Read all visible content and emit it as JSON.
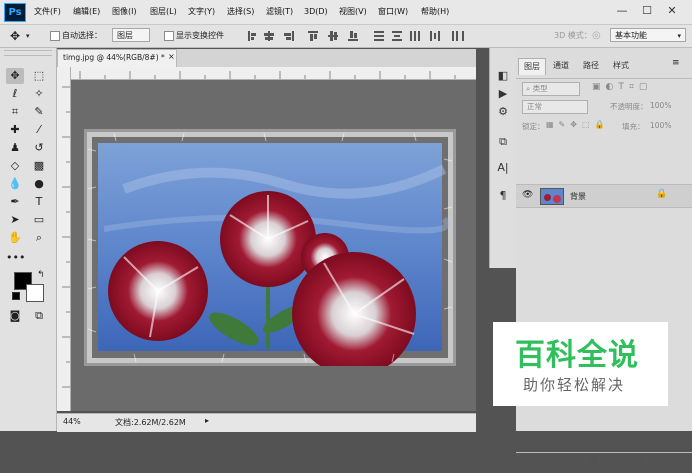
{
  "app": {
    "logo": "Ps"
  },
  "menu": [
    "文件(F)",
    "编辑(E)",
    "图像(I)",
    "图层(L)",
    "文字(Y)",
    "选择(S)",
    "滤镜(T)",
    "3D(D)",
    "视图(V)",
    "窗口(W)",
    "帮助(H)"
  ],
  "window_controls": {
    "minimize": "—",
    "maximize": "☐",
    "close": "✕"
  },
  "options": {
    "auto_select_label": "自动选择：",
    "auto_select_value": "图层",
    "show_transform_label": "显示变换控件",
    "mode_3d_label": "3D 模式：",
    "workspace": "基本功能"
  },
  "document": {
    "tab_title": "timg.jpg @ 44%(RGB/8#) *",
    "zoom": "44%",
    "doc_info": "文档:2.62M/2.62M"
  },
  "layers_panel": {
    "tabs": [
      "图层",
      "通道",
      "路径",
      "样式"
    ],
    "filter_kind": "类型",
    "blend_mode": "正常",
    "opacity_label": "不透明度：",
    "opacity_value": "100%",
    "lock_label": "锁定：",
    "fill_label": "填充：",
    "fill_value": "100%",
    "layers": [
      {
        "name": "背景"
      }
    ]
  },
  "watermark": {
    "title": "百科全说",
    "subtitle": "助你轻松解决"
  },
  "colors": {
    "accent": "#31a8ff",
    "watermark_green": "#2fbf5b"
  }
}
